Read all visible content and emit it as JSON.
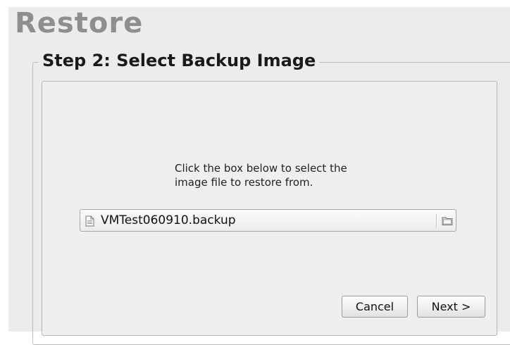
{
  "page": {
    "title": "Restore"
  },
  "step": {
    "legend": "Step 2: Select Backup Image"
  },
  "instructions": {
    "line1": "Click the box below to select the",
    "line2": "image file to restore from."
  },
  "file_field": {
    "value": "VMTest060910.backup",
    "file_icon": "document-icon",
    "browse_icon": "folder-icon"
  },
  "buttons": {
    "cancel": "Cancel",
    "next": "Next >"
  }
}
